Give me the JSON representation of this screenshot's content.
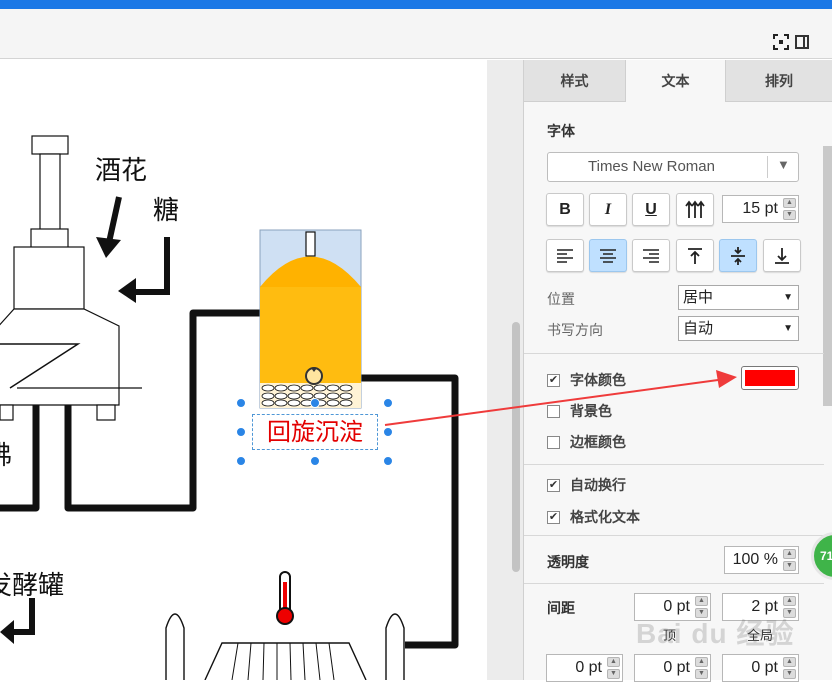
{
  "toolbar": {
    "fullscreen_icon": "fullscreen-icon",
    "panel_toggle_icon": "panel-toggle-icon"
  },
  "canvas": {
    "labels": {
      "hops": "酒花",
      "sugar": "糖",
      "whirlpool": "回旋沉淀",
      "fermenter_partial": "发酵罐",
      "boil_partial": "沸"
    },
    "text_color": "#e30000",
    "accent_color": "#ffb000",
    "selection_color": "#2a85e6"
  },
  "tabs": [
    {
      "label": "样式",
      "active": false
    },
    {
      "label": "文本",
      "active": true
    },
    {
      "label": "排列",
      "active": false
    }
  ],
  "font": {
    "section_label": "字体",
    "family": "Times New Roman",
    "size": "15 pt",
    "bold_label": "B",
    "italic_label": "I",
    "underline_label": "U",
    "vertical_icon": "vertical-text-icon",
    "align_left_icon": "align-left-icon",
    "align_center_icon": "align-center-icon",
    "align_right_icon": "align-right-icon",
    "valign_top_icon": "valign-top-icon",
    "valign_middle_icon": "valign-middle-icon",
    "valign_bottom_icon": "valign-bottom-icon"
  },
  "position": {
    "label": "位置",
    "value": "居中"
  },
  "writing_direction": {
    "label": "书写方向",
    "value": "自动"
  },
  "colors": {
    "font_color": {
      "label": "字体颜色",
      "checked": true,
      "value": "#ff0000"
    },
    "background": {
      "label": "背景色",
      "checked": false
    },
    "border": {
      "label": "边框颜色",
      "checked": false
    }
  },
  "options": {
    "word_wrap": {
      "label": "自动换行",
      "checked": true
    },
    "formatted_text": {
      "label": "格式化文本",
      "checked": true
    }
  },
  "opacity": {
    "label": "透明度",
    "value": "100 %"
  },
  "spacing": {
    "label": "间距",
    "top": "0 pt",
    "global": "2 pt",
    "top_label": "顶",
    "global_label": "全局",
    "left": "0 pt",
    "middle": "0 pt",
    "right": "0 pt"
  },
  "badge": {
    "text": "71"
  },
  "watermark": {
    "text": "Bai du 经验"
  }
}
